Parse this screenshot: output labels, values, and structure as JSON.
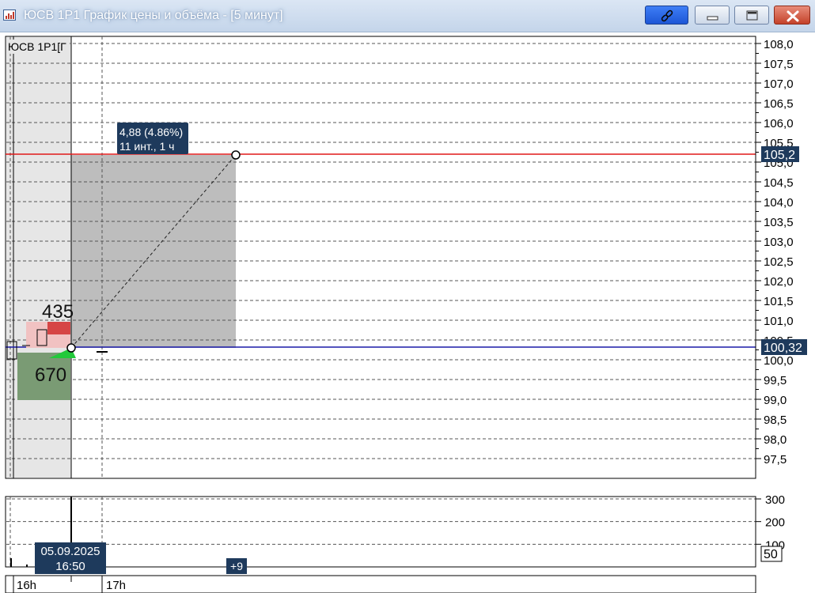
{
  "window": {
    "title": "ЮСВ 1Р1 График цены и объёма - [5 минут]"
  },
  "chart": {
    "instrument_label": "ЮСВ 1Р1[Г",
    "price_axis_ticks": [
      "108,0",
      "107,5",
      "107,0",
      "106,5",
      "106,0",
      "105,5",
      "105,0",
      "104,5",
      "104,0",
      "103,5",
      "103,0",
      "102,5",
      "102,0",
      "101,5",
      "101,0",
      "100,5",
      "100,0",
      "99,5",
      "99,0",
      "98,5",
      "98,0",
      "97,5"
    ],
    "volume_axis_ticks": [
      "300",
      "200",
      "100"
    ],
    "volume_current": "50",
    "time_ticks": [
      "16h",
      "17h"
    ],
    "cursor_time": {
      "date": "05.09.2025",
      "time": "16:50"
    },
    "hidden_count": "+9",
    "measure": {
      "change": "4,88 (4.86%)",
      "span": "11 инт., 1 ч"
    },
    "levels": {
      "red": {
        "label": "105,2",
        "color": "#e01818"
      },
      "blue": {
        "label": "100,32",
        "color": "#1a1aa8"
      }
    },
    "order_book": {
      "ask_volume": "435",
      "bid_volume": "670"
    }
  },
  "chart_data": {
    "type": "line",
    "x": [
      "16h",
      "17h"
    ],
    "ylim": [
      97.3,
      108.1
    ],
    "price_levels": [
      105.2,
      100.32
    ],
    "measure_from": 100.32,
    "measure_to": 105.2,
    "volume_ylim": [
      0,
      300
    ],
    "volume_current": 50
  },
  "icons": {
    "app": "chart-app-icon",
    "link": "link-icon",
    "minimize": "minimize-icon",
    "maximize": "maximize-icon",
    "close": "close-icon"
  }
}
